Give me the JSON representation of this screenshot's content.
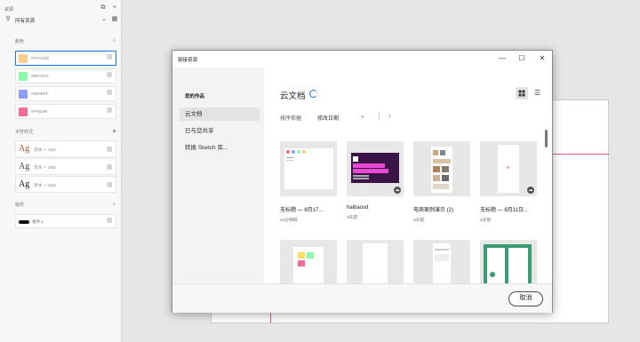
{
  "panel": {
    "title": "资源",
    "filter_label": "所有资源",
    "colors_header": "颜色",
    "char_styles_header": "字符样式",
    "components_header": "组件",
    "colors": [
      {
        "label": "#FFCD8D",
        "hex": "#FFCD8D"
      },
      {
        "label": "#8DF9AC",
        "hex": "#8DF9AC"
      },
      {
        "label": "#8D9DFF",
        "hex": "#8D9DFF"
      },
      {
        "label": "#FF8D8F",
        "hex": "#F56B9C"
      }
    ],
    "char_styles": [
      {
        "glyph": "Ag",
        "label": "黑体 — 40pt",
        "hex": "#A0522D"
      },
      {
        "glyph": "Ag",
        "label": "黑体 — 20pt",
        "hex": "#444444"
      },
      {
        "glyph": "Ag",
        "label": "黑体 — 32pt",
        "hex": "#111111"
      }
    ],
    "component": {
      "label": "组件 1"
    }
  },
  "dialog": {
    "title": "链接资源",
    "sidebar_header": "您的作品",
    "nav": [
      "云文档",
      "已与您共享",
      "转换 Sketch 库..."
    ],
    "main_title": "云文档",
    "sort_label": "排序依据",
    "sort_value": "修改日期",
    "cancel_label": "取消",
    "cards": [
      {
        "name": "无标题 — 8月17...",
        "time": "14分钟前",
        "thumb": "web"
      },
      {
        "name": "haibaosd",
        "time": "3天前",
        "thumb": "poster"
      },
      {
        "name": "电商案例演示 (2)",
        "time": "3天前",
        "thumb": "ecommerce"
      },
      {
        "name": "无标题 — 8月11日...",
        "time": "4天前",
        "thumb": "blank"
      }
    ]
  }
}
